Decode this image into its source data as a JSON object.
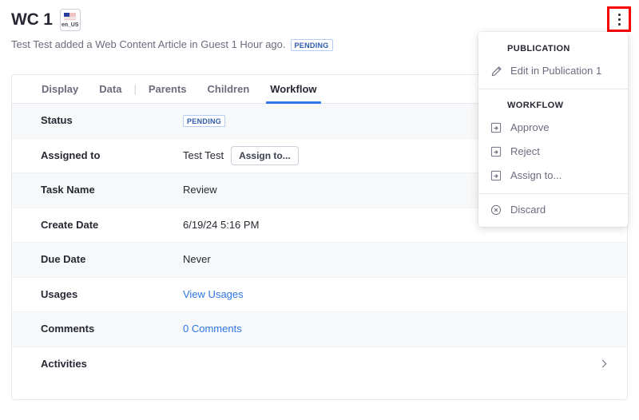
{
  "header": {
    "title": "WC 1",
    "locale_badge": {
      "icon": "us-flag-icon",
      "label": "en_US"
    },
    "subtitle": "Test Test added a Web Content Article in Guest 1 Hour ago.",
    "status_badge": "PENDING",
    "kebab_icon": "kebab-menu-icon"
  },
  "tabs": [
    {
      "label": "Display",
      "active": false
    },
    {
      "label": "Data",
      "active": false
    },
    {
      "label": "Parents",
      "active": false
    },
    {
      "label": "Children",
      "active": false
    },
    {
      "label": "Workflow",
      "active": true
    }
  ],
  "tab_separator": "|",
  "table": {
    "rows": [
      {
        "label": "Status",
        "value": "PENDING",
        "kind": "badge"
      },
      {
        "label": "Assigned to",
        "value": "Test Test",
        "kind": "text-button",
        "button": "Assign to..."
      },
      {
        "label": "Task Name",
        "value": "Review",
        "kind": "text"
      },
      {
        "label": "Create Date",
        "value": "6/19/24 5:16 PM",
        "kind": "text"
      },
      {
        "label": "Due Date",
        "value": "Never",
        "kind": "text"
      },
      {
        "label": "Usages",
        "value": "View Usages",
        "kind": "link"
      },
      {
        "label": "Comments",
        "value": "0 Comments",
        "kind": "link"
      },
      {
        "label": "Activities",
        "value": "",
        "kind": "expander"
      }
    ]
  },
  "dropdown": {
    "groups": [
      {
        "title": "PUBLICATION",
        "items": [
          {
            "label": "Edit in Publication 1",
            "icon": "pencil-icon"
          }
        ]
      },
      {
        "title": "WORKFLOW",
        "items": [
          {
            "label": "Approve",
            "icon": "workflow-transition-icon"
          },
          {
            "label": "Reject",
            "icon": "workflow-transition-icon"
          },
          {
            "label": "Assign to...",
            "icon": "workflow-transition-icon"
          }
        ]
      },
      {
        "title": "",
        "items": [
          {
            "label": "Discard",
            "icon": "circle-x-icon"
          }
        ]
      }
    ]
  },
  "colors": {
    "accent": "#2e76e6",
    "highlight_box": "#ff0000",
    "text_primary": "#272833",
    "text_secondary": "#6b6c7e",
    "row_shade": "#f7f8f9",
    "border": "#e7e7ed"
  }
}
